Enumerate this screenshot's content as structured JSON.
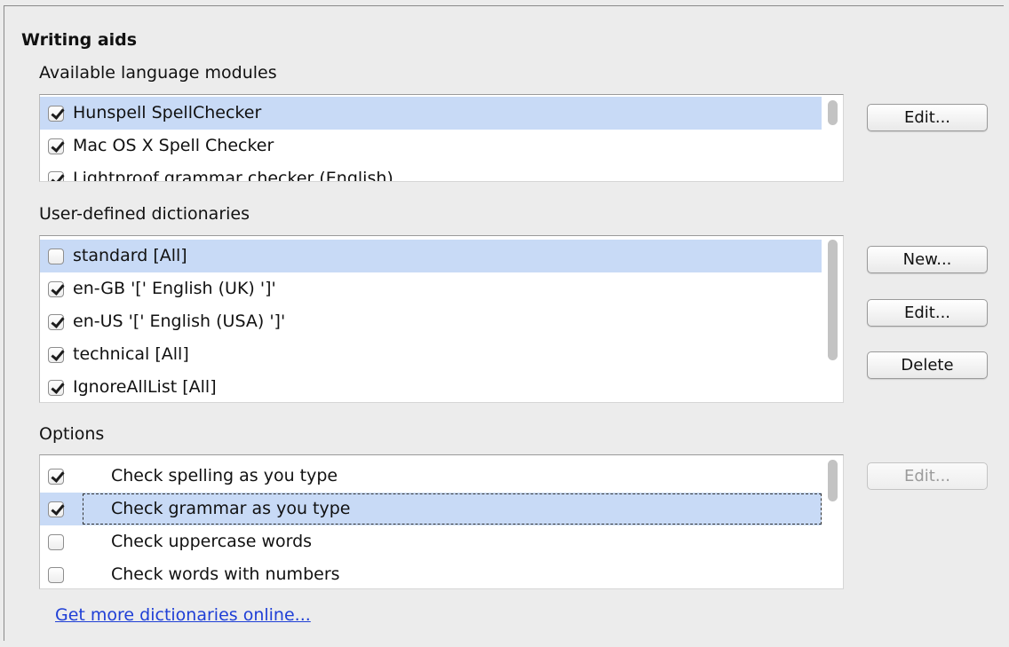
{
  "section_title": "Writing aids",
  "modules": {
    "label": "Available language modules",
    "items": [
      {
        "label": "Hunspell SpellChecker",
        "checked": true,
        "selected": true
      },
      {
        "label": "Mac OS X Spell Checker",
        "checked": true,
        "selected": false
      },
      {
        "label": "Lightproof grammar checker (English)",
        "checked": true,
        "selected": false
      }
    ],
    "edit_label": "Edit..."
  },
  "dictionaries": {
    "label": "User-defined dictionaries",
    "items": [
      {
        "label": "standard [All]",
        "checked": false,
        "selected": true
      },
      {
        "label": "en-GB  '[' English (UK) ']'",
        "checked": true,
        "selected": false
      },
      {
        "label": "en-US  '[' English (USA) ']'",
        "checked": true,
        "selected": false
      },
      {
        "label": "technical [All]",
        "checked": true,
        "selected": false
      },
      {
        "label": "IgnoreAllList [All]",
        "checked": true,
        "selected": false
      }
    ],
    "new_label": "New...",
    "edit_label": "Edit...",
    "delete_label": "Delete"
  },
  "options": {
    "label": "Options",
    "items": [
      {
        "label": "Check spelling as you type",
        "checked": true,
        "selected": false
      },
      {
        "label": "Check grammar as you type",
        "checked": true,
        "selected": true
      },
      {
        "label": "Check uppercase words",
        "checked": false,
        "selected": false
      },
      {
        "label": "Check words with numbers",
        "checked": false,
        "selected": false
      }
    ],
    "edit_label": "Edit..."
  },
  "more_dictionaries_link": "Get more dictionaries online..."
}
